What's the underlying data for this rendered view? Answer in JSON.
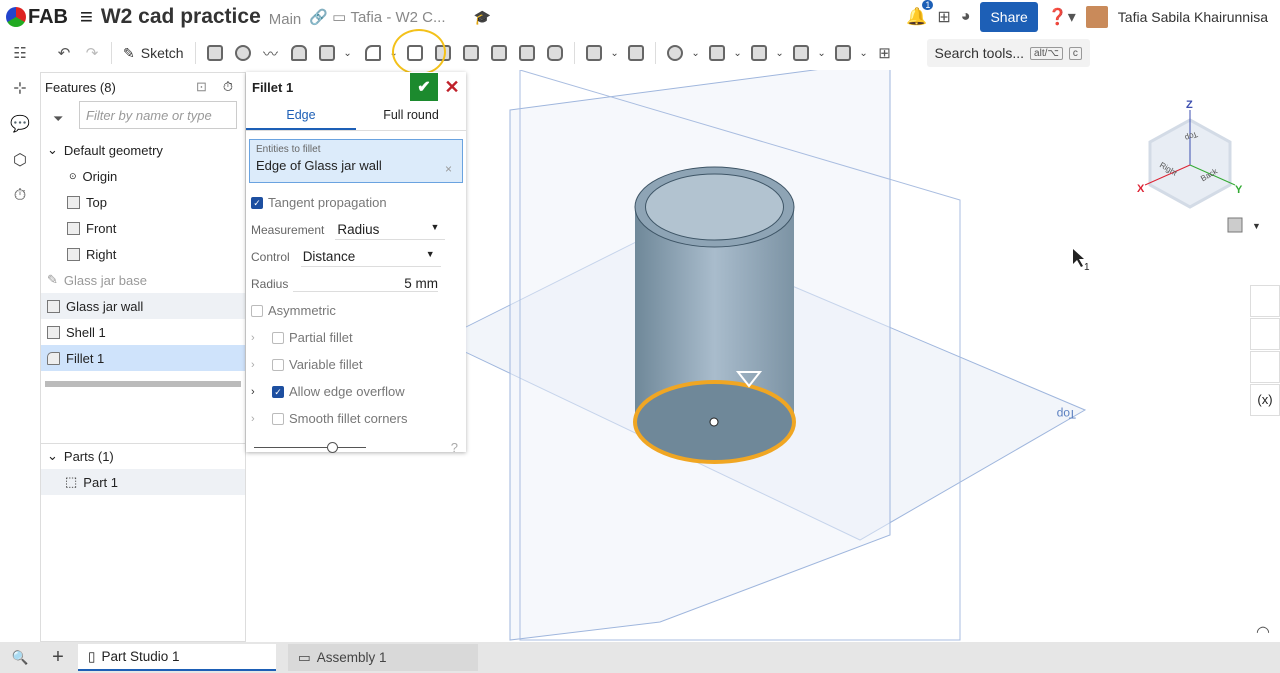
{
  "app": {
    "logo": "FAB",
    "doc_title": "W2 cad practice",
    "branch": "Main",
    "folder": "Tafia - W2 C...",
    "notifications": "1",
    "share": "Share",
    "user": "Tafia Sabila Khairunnisa"
  },
  "toolbar": {
    "sketch": "Sketch",
    "search": "Search tools...",
    "shortcut1": "alt/⌥",
    "shortcut2": "c",
    "highlight_color": "#f3c11a"
  },
  "features": {
    "title": "Features (8)",
    "filter_placeholder": "Filter by name or type",
    "items": [
      {
        "label": "Default geometry"
      },
      {
        "label": "Origin"
      },
      {
        "label": "Top"
      },
      {
        "label": "Front"
      },
      {
        "label": "Right"
      },
      {
        "label": "Glass jar base"
      },
      {
        "label": "Glass jar wall"
      },
      {
        "label": "Shell 1"
      },
      {
        "label": "Fillet 1"
      }
    ],
    "parts_title": "Parts (1)",
    "part": "Part 1"
  },
  "fillet": {
    "title": "Fillet 1",
    "tabs": [
      "Edge",
      "Full round"
    ],
    "entities_label": "Entities to fillet",
    "entities_value": "Edge of Glass jar wall",
    "tangent": "Tangent propagation",
    "measurement_label": "Measurement",
    "measurement": "Radius",
    "control_label": "Control",
    "control": "Distance",
    "radius_label": "Radius",
    "radius": "5 mm",
    "asymmetric": "Asymmetric",
    "partial": "Partial fillet",
    "variable": "Variable fillet",
    "overflow": "Allow edge overflow",
    "smooth": "Smooth fillet corners",
    "slider_value": 0.7
  },
  "viewcube": {
    "z": "Z",
    "x": "X",
    "y": "Y",
    "top": "Top",
    "right": "Right",
    "back": "Back"
  },
  "plane_label": "Top",
  "cursor_badge": "1",
  "tabs": {
    "part_studio": "Part Studio 1",
    "assembly": "Assembly 1"
  }
}
